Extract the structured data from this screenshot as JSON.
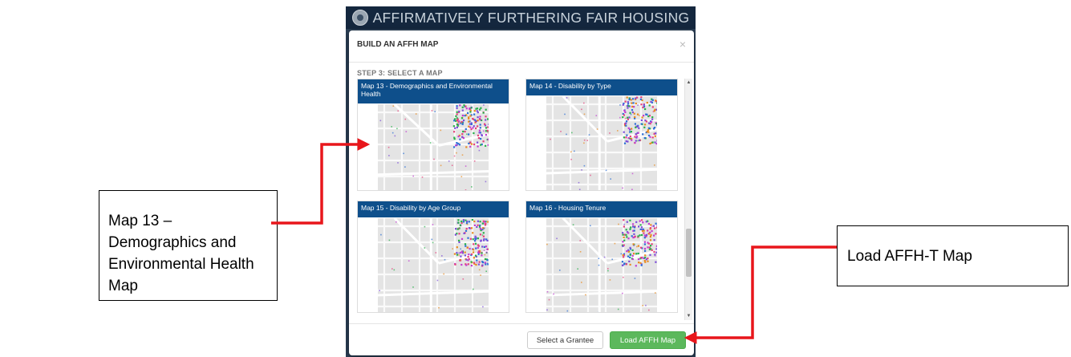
{
  "app": {
    "title": "AFFIRMATIVELY FURTHERING FAIR HOUSING",
    "logo_icon": "hud-seal-icon"
  },
  "modal": {
    "title": "BUILD AN AFFH MAP",
    "close_glyph": "×",
    "step_label": "STEP 3: SELECT A MAP",
    "maps": [
      {
        "label": "Map 13 - Demographics and Environmental Health"
      },
      {
        "label": "Map 14 - Disability by Type"
      },
      {
        "label": "Map 15 - Disability by Age Group"
      },
      {
        "label": "Map 16 - Housing Tenure"
      }
    ],
    "scroll_up_glyph": "▲",
    "scroll_down_glyph": "▼",
    "footer": {
      "select_grantee_label": "Select a Grantee",
      "load_map_label": "Load AFFH Map"
    }
  },
  "annotations": {
    "left_callout": "Map 13 – Demographics and Environmental Health Map",
    "right_callout": "Load AFFH-T Map",
    "arrow_color": "#e8161b"
  },
  "colors": {
    "header_bg": "#14273e",
    "card_header_bg": "#0e4f8b",
    "success": "#5cb85c"
  }
}
